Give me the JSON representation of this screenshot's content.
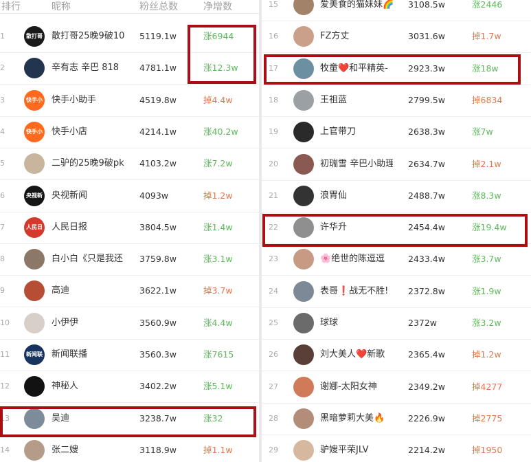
{
  "colors": {
    "highlight": "#a90f12",
    "increase": "#5cba5a",
    "decrease": "#e1784f"
  },
  "header": {
    "rank": "排行",
    "nickname": "昵称",
    "fans": "粉丝总数",
    "net_change": "净增数"
  },
  "left_rows": [
    {
      "rank": "1",
      "name": "散打哥25晚9破10",
      "fans": "5119.1w",
      "delta": "涨6944",
      "dir": "up",
      "avatar_text": "散打哥",
      "avatar_color": "#1a1a1a"
    },
    {
      "rank": "2",
      "name": "辛有志 辛巴 818",
      "fans": "4781.1w",
      "delta": "涨12.3w",
      "dir": "up",
      "avatar_text": "",
      "avatar_color": "#23344f"
    },
    {
      "rank": "3",
      "name": "快手小助手",
      "fans": "4519.8w",
      "delta": "掉4.4w",
      "dir": "down",
      "avatar_text": "快手小助手",
      "avatar_color": "#ff6a1f"
    },
    {
      "rank": "4",
      "name": "快手小店",
      "fans": "4214.1w",
      "delta": "涨40.2w",
      "dir": "up",
      "avatar_text": "快手小店",
      "avatar_color": "#ff6a1f"
    },
    {
      "rank": "5",
      "name": "二驴的25晚9破pk",
      "fans": "4103.2w",
      "delta": "涨7.2w",
      "dir": "up",
      "avatar_text": "",
      "avatar_color": "#c9b59d"
    },
    {
      "rank": "6",
      "name": "央视新闻",
      "fans": "4093w",
      "delta": "掉1.2w",
      "dir": "down",
      "avatar_text": "央视新闻",
      "avatar_color": "#151515"
    },
    {
      "rank": "7",
      "name": "人民日报",
      "fans": "3804.5w",
      "delta": "涨1.4w",
      "dir": "up",
      "avatar_text": "人民日报",
      "avatar_color": "#d33a2c"
    },
    {
      "rank": "8",
      "name": "白小白《只是我还",
      "fans": "3759.8w",
      "delta": "涨3.1w",
      "dir": "up",
      "avatar_text": "",
      "avatar_color": "#8c7866"
    },
    {
      "rank": "9",
      "name": "高迪",
      "fans": "3622.1w",
      "delta": "掉3.7w",
      "dir": "down",
      "avatar_text": "",
      "avatar_color": "#b64d35"
    },
    {
      "rank": "10",
      "name": "小伊伊",
      "fans": "3560.9w",
      "delta": "涨4.4w",
      "dir": "up",
      "avatar_text": "",
      "avatar_color": "#d7cfc8"
    },
    {
      "rank": "11",
      "name": "新闻联播",
      "fans": "3560.3w",
      "delta": "涨7615",
      "dir": "up",
      "avatar_text": "新闻联播",
      "avatar_color": "#16345f"
    },
    {
      "rank": "12",
      "name": "神秘人",
      "fans": "3402.2w",
      "delta": "涨5.1w",
      "dir": "up",
      "avatar_text": "",
      "avatar_color": "#121212"
    },
    {
      "rank": "13",
      "name": "吴迪",
      "fans": "3238.7w",
      "delta": "涨32",
      "dir": "up",
      "avatar_text": "",
      "avatar_color": "#7c8c9a"
    },
    {
      "rank": "14",
      "name": "张二嫂",
      "fans": "3118.9w",
      "delta": "掉1.1w",
      "dir": "down",
      "avatar_text": "",
      "avatar_color": "#b59c88"
    }
  ],
  "right_rows": [
    {
      "rank": "15",
      "name": "爱美食的猫妹妹🌈",
      "fans": "3108.5w",
      "delta": "涨2446",
      "dir": "up",
      "avatar_text": "",
      "avatar_color": "#a3826a"
    },
    {
      "rank": "16",
      "name": "FZ方丈",
      "fans": "3031.6w",
      "delta": "掉1.7w",
      "dir": "down",
      "avatar_text": "",
      "avatar_color": "#caa08a"
    },
    {
      "rank": "17",
      "name": "牧童❤️和平精英-",
      "fans": "2923.3w",
      "delta": "涨18w",
      "dir": "up",
      "avatar_text": "",
      "avatar_color": "#6d8fa2"
    },
    {
      "rank": "18",
      "name": "王祖蓝",
      "fans": "2799.5w",
      "delta": "掉6834",
      "dir": "down",
      "avatar_text": "",
      "avatar_color": "#9aa0a4"
    },
    {
      "rank": "19",
      "name": "上官带刀",
      "fans": "2638.3w",
      "delta": "涨7w",
      "dir": "up",
      "avatar_text": "",
      "avatar_color": "#2a2a2a"
    },
    {
      "rank": "20",
      "name": "初瑞雪 辛巴小助理",
      "fans": "2634.7w",
      "delta": "掉2.1w",
      "dir": "down",
      "avatar_text": "",
      "avatar_color": "#8a5a52"
    },
    {
      "rank": "21",
      "name": "浪胃仙",
      "fans": "2488.7w",
      "delta": "涨8.3w",
      "dir": "up",
      "avatar_text": "",
      "avatar_color": "#333333"
    },
    {
      "rank": "22",
      "name": "许华升",
      "fans": "2454.4w",
      "delta": "涨19.4w",
      "dir": "up",
      "avatar_text": "",
      "avatar_color": "#8f8f8f"
    },
    {
      "rank": "23",
      "name": "🌸绝世的陈逗逗",
      "fans": "2433.4w",
      "delta": "涨3.7w",
      "dir": "up",
      "avatar_text": "",
      "avatar_color": "#c79a84"
    },
    {
      "rank": "24",
      "name": "表哥❗战无不胜!",
      "fans": "2372.8w",
      "delta": "涨1.9w",
      "dir": "up",
      "avatar_text": "",
      "avatar_color": "#7d8996"
    },
    {
      "rank": "25",
      "name": "球球",
      "fans": "2372w",
      "delta": "涨3.2w",
      "dir": "up",
      "avatar_text": "",
      "avatar_color": "#6b6b6b"
    },
    {
      "rank": "26",
      "name": "刘大美人❤️新歌",
      "fans": "2365.4w",
      "delta": "掉1.2w",
      "dir": "down",
      "avatar_text": "",
      "avatar_color": "#5a3f38"
    },
    {
      "rank": "27",
      "name": "谢娜-太阳女神",
      "fans": "2349.2w",
      "delta": "掉4277",
      "dir": "down",
      "avatar_text": "",
      "avatar_color": "#d07a5a"
    },
    {
      "rank": "28",
      "name": "黑暗萝莉大美🔥",
      "fans": "2226.9w",
      "delta": "掉2775",
      "dir": "down",
      "avatar_text": "",
      "avatar_color": "#b38c7a"
    },
    {
      "rank": "29",
      "name": "驴嫂平荣JLV",
      "fans": "2214.2w",
      "delta": "掉1950",
      "dir": "down",
      "avatar_text": "",
      "avatar_color": "#d6b89e"
    }
  ]
}
